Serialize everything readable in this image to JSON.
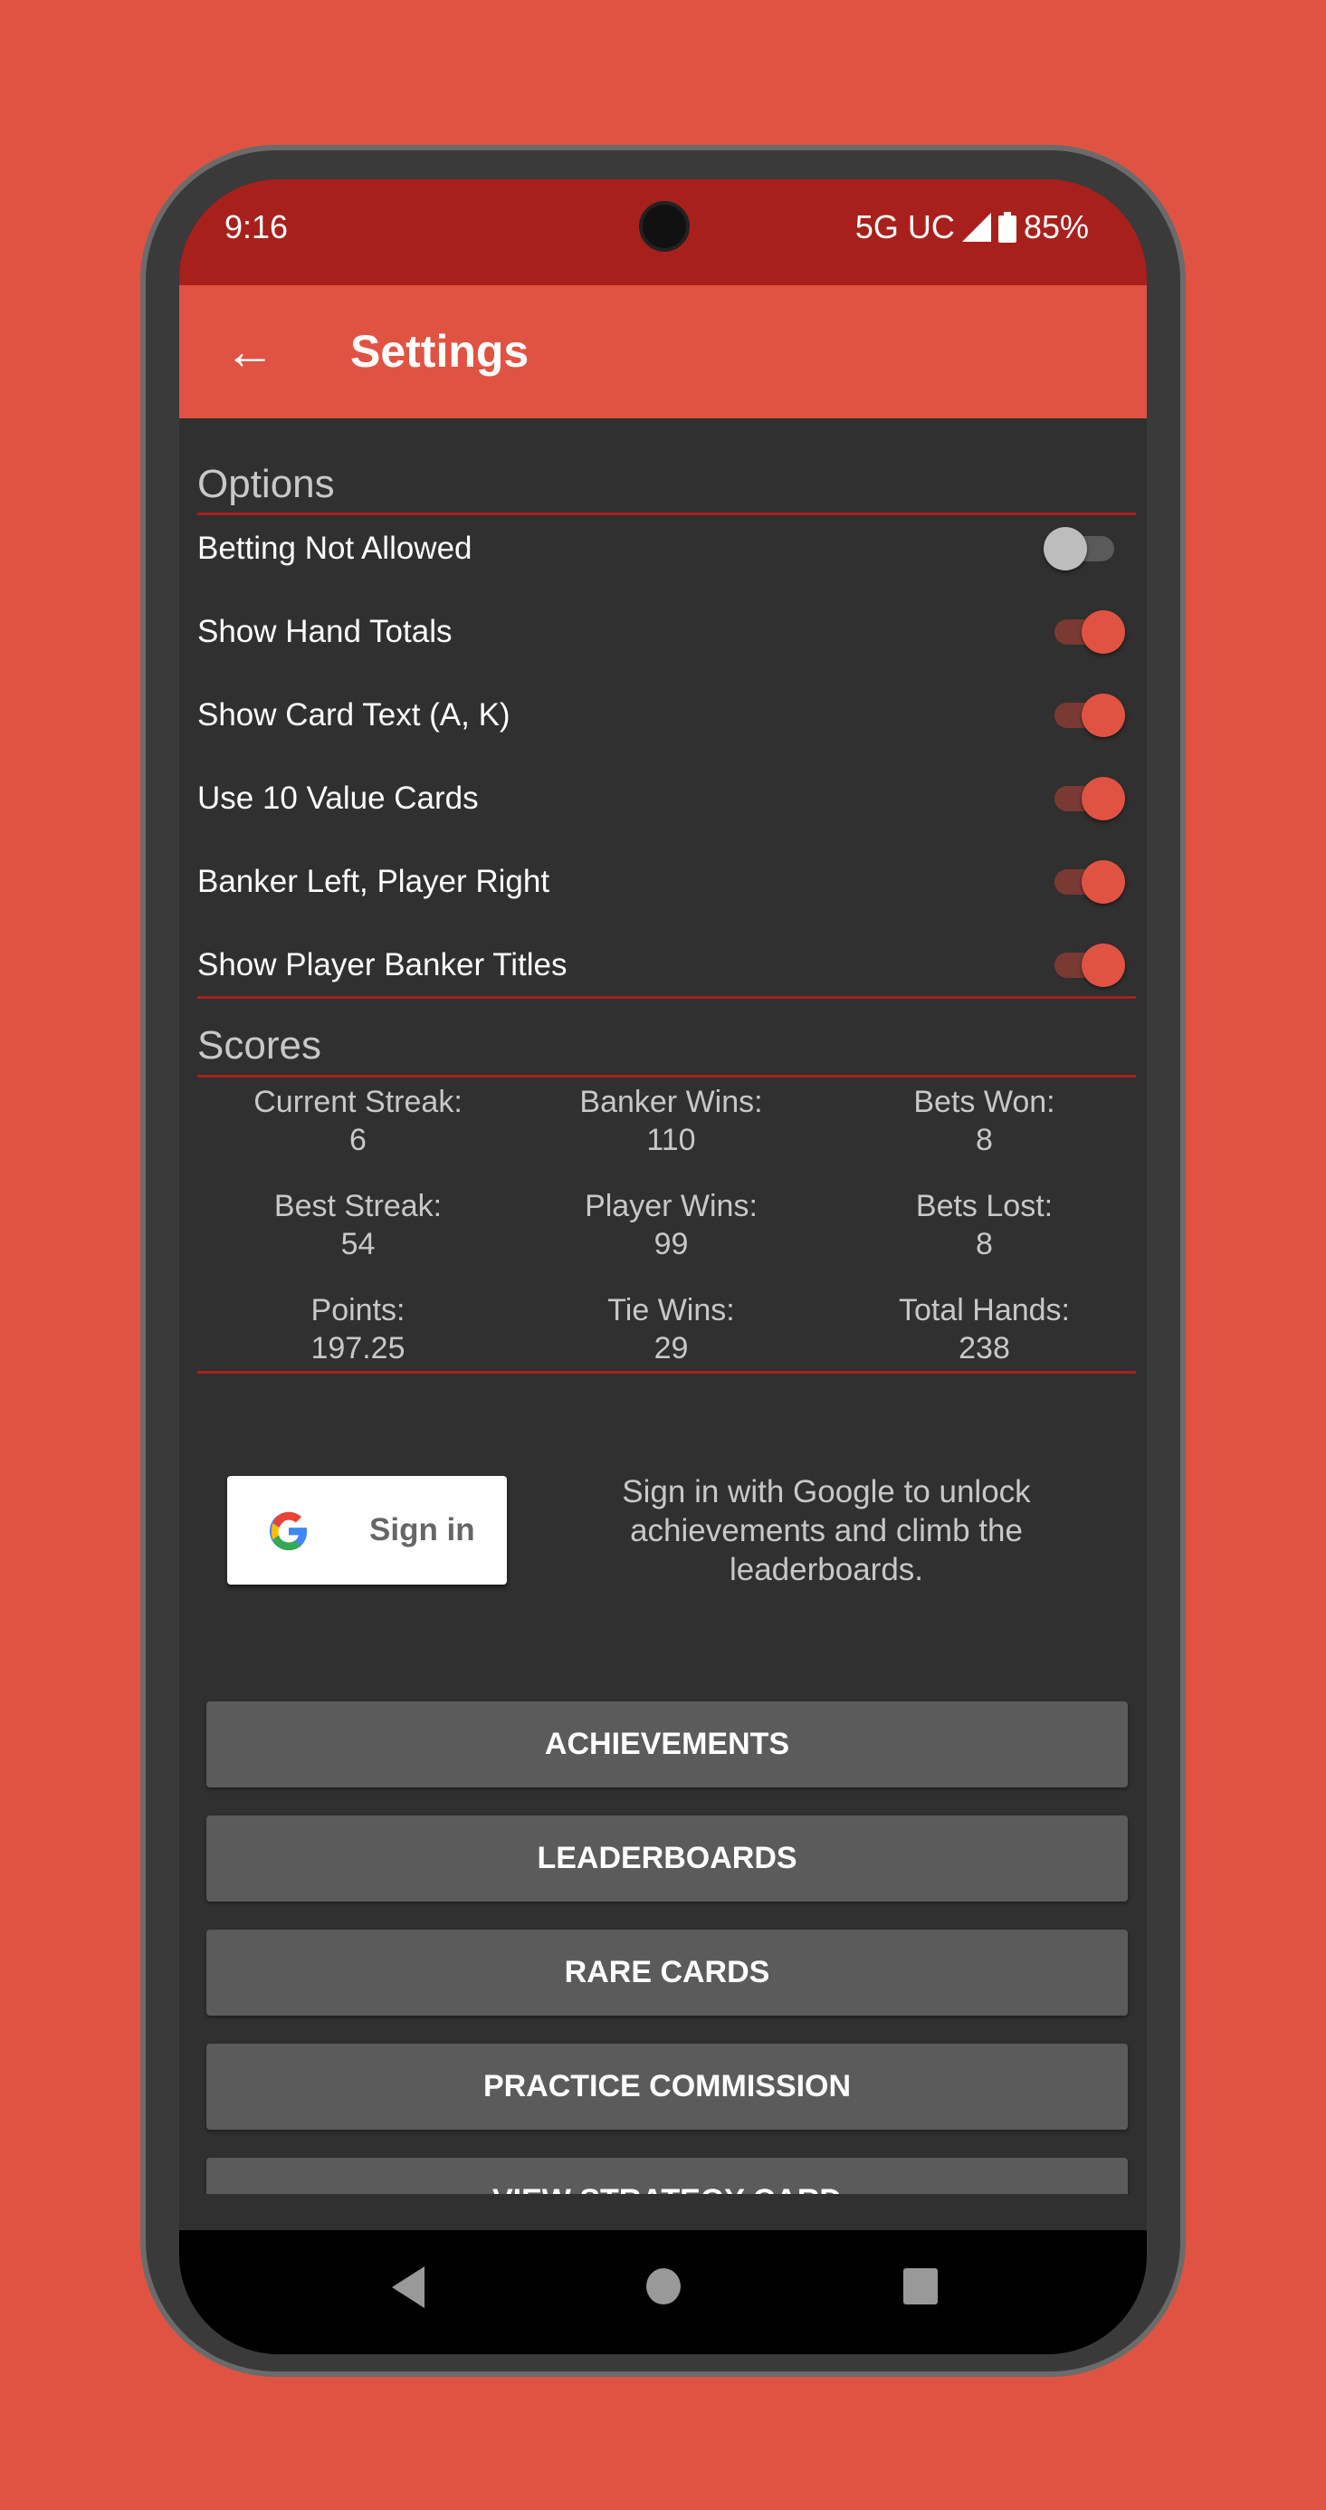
{
  "status_bar": {
    "time": "9:16",
    "network": "5G UC",
    "battery": "85%"
  },
  "app_bar": {
    "title": "Settings",
    "back_icon": "arrow-left-icon"
  },
  "options": {
    "header": "Options",
    "items": [
      {
        "label": "Betting Not Allowed",
        "on": false
      },
      {
        "label": "Show Hand Totals",
        "on": true
      },
      {
        "label": "Show Card Text (A, K)",
        "on": true
      },
      {
        "label": "Use 10 Value Cards",
        "on": true
      },
      {
        "label": "Banker Left, Player Right",
        "on": true
      },
      {
        "label": "Show Player Banker Titles",
        "on": true
      }
    ]
  },
  "scores": {
    "header": "Scores",
    "items": [
      {
        "label": "Current Streak:",
        "value": "6"
      },
      {
        "label": "Banker Wins:",
        "value": "110"
      },
      {
        "label": "Bets Won:",
        "value": "8"
      },
      {
        "label": "Best Streak:",
        "value": "54"
      },
      {
        "label": "Player Wins:",
        "value": "99"
      },
      {
        "label": "Bets Lost:",
        "value": "8"
      },
      {
        "label": "Points:",
        "value": "197.25"
      },
      {
        "label": "Tie Wins:",
        "value": "29"
      },
      {
        "label": "Total Hands:",
        "value": "238"
      }
    ]
  },
  "signin": {
    "button_label": "Sign in",
    "description": "Sign in with Google to unlock achievements and climb the leaderboards."
  },
  "buttons": [
    "ACHIEVEMENTS",
    "LEADERBOARDS",
    "RARE CARDS",
    "PRACTICE COMMISSION",
    "VIEW STRATEGY CARD"
  ],
  "colors": {
    "background": "#e05342",
    "status_bar": "#a8201c",
    "app_bar": "#e05342",
    "content": "#303030",
    "button": "#5b5b5c"
  }
}
